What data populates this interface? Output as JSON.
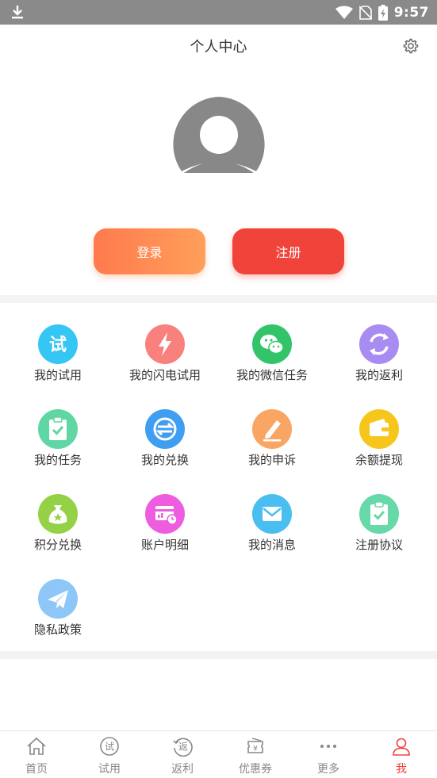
{
  "status_bar": {
    "time": "9:57"
  },
  "header": {
    "title": "个人中心"
  },
  "auth": {
    "login_label": "登录",
    "register_label": "注册"
  },
  "colors": {
    "accent": "#f0443a",
    "login_start": "#ff7a4e",
    "login_end": "#ff9f5a"
  },
  "menu": [
    {
      "label": "我的试用",
      "icon": "trial-icon"
    },
    {
      "label": "我的闪电试用",
      "icon": "lightning-icon"
    },
    {
      "label": "我的微信任务",
      "icon": "wechat-icon"
    },
    {
      "label": "我的返利",
      "icon": "refresh-icon"
    },
    {
      "label": "我的任务",
      "icon": "clipboard-check-icon"
    },
    {
      "label": "我的兑换",
      "icon": "exchange-icon"
    },
    {
      "label": "我的申诉",
      "icon": "edit-icon"
    },
    {
      "label": "余额提现",
      "icon": "wallet-icon"
    },
    {
      "label": "积分兑换",
      "icon": "money-bag-icon"
    },
    {
      "label": "账户明细",
      "icon": "account-detail-icon"
    },
    {
      "label": "我的消息",
      "icon": "mail-icon"
    },
    {
      "label": "注册协议",
      "icon": "agreement-icon"
    },
    {
      "label": "隐私政策",
      "icon": "paper-plane-icon"
    }
  ],
  "bottom_nav": [
    {
      "label": "首页",
      "icon": "home-icon"
    },
    {
      "label": "试用",
      "icon": "trial-nav-icon"
    },
    {
      "label": "返利",
      "icon": "rebate-nav-icon"
    },
    {
      "label": "优惠券",
      "icon": "coupon-icon"
    },
    {
      "label": "更多",
      "icon": "more-icon"
    },
    {
      "label": "我",
      "icon": "user-icon",
      "active": true
    }
  ]
}
